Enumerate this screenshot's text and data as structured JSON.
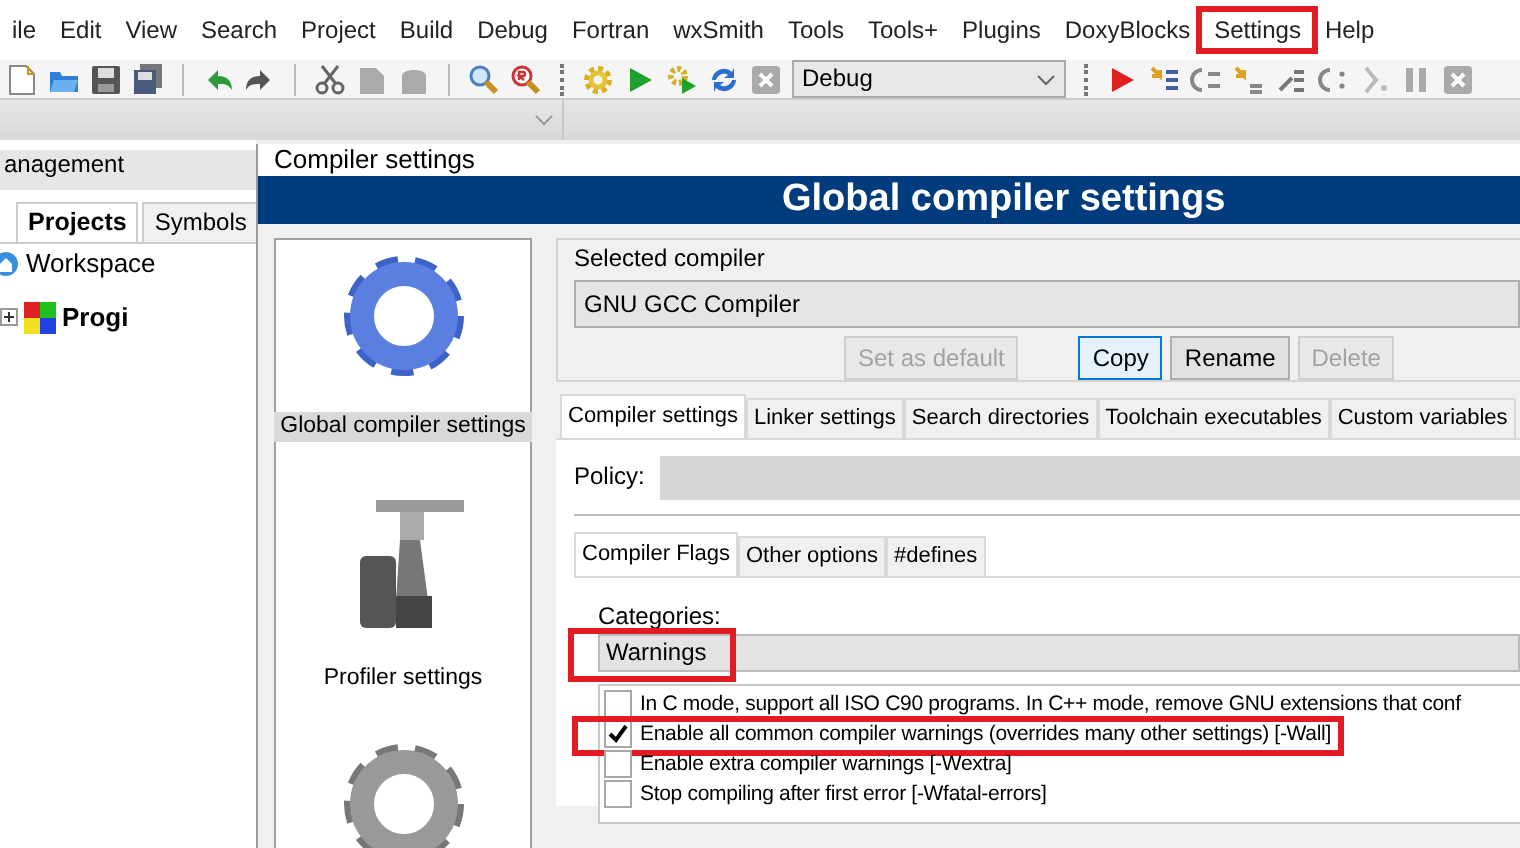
{
  "menu": [
    {
      "label": "ile",
      "highlighted": false
    },
    {
      "label": "Edit",
      "highlighted": false
    },
    {
      "label": "View",
      "highlighted": false
    },
    {
      "label": "Search",
      "highlighted": false
    },
    {
      "label": "Project",
      "highlighted": false
    },
    {
      "label": "Build",
      "highlighted": false
    },
    {
      "label": "Debug",
      "highlighted": false
    },
    {
      "label": "Fortran",
      "highlighted": false
    },
    {
      "label": "wxSmith",
      "highlighted": false
    },
    {
      "label": "Tools",
      "highlighted": false
    },
    {
      "label": "Tools+",
      "highlighted": false
    },
    {
      "label": "Plugins",
      "highlighted": false
    },
    {
      "label": "DoxyBlocks",
      "highlighted": false
    },
    {
      "label": "Settings",
      "highlighted": true
    },
    {
      "label": "Help",
      "highlighted": false
    }
  ],
  "toolbar": {
    "build_target": "Debug"
  },
  "management": {
    "title": "anagement",
    "tabs": [
      {
        "label": "Projects",
        "selected": true
      },
      {
        "label": "Symbols",
        "selected": false
      }
    ],
    "tree": [
      {
        "label": "Workspace",
        "kind": "workspace",
        "active": false,
        "children": [
          {
            "label": "Progi",
            "kind": "project",
            "active": true,
            "expanded": false
          }
        ]
      }
    ]
  },
  "dialog": {
    "title": "Compiler settings",
    "banner": "Global compiler settings",
    "pages": [
      {
        "label": "Global compiler settings",
        "kind": "gear",
        "selected": true
      },
      {
        "label": "Profiler settings",
        "kind": "caliper",
        "selected": false
      },
      {
        "kind": "gear-gray",
        "selected": false
      }
    ],
    "selected_compiler": {
      "legend": "Selected compiler",
      "value": "GNU GCC Compiler",
      "buttons": [
        {
          "label": "Set as default",
          "disabled": true,
          "focused": false
        },
        {
          "label": "Copy",
          "disabled": false,
          "focused": true
        },
        {
          "label": "Rename",
          "disabled": false,
          "focused": false
        },
        {
          "label": "Delete",
          "disabled": true,
          "focused": false
        }
      ]
    },
    "tabs": [
      {
        "label": "Compiler settings",
        "selected": true
      },
      {
        "label": "Linker settings",
        "selected": false
      },
      {
        "label": "Search directories",
        "selected": false
      },
      {
        "label": "Toolchain executables",
        "selected": false
      },
      {
        "label": "Custom variables",
        "selected": false
      }
    ],
    "policy": {
      "label": "Policy:"
    },
    "sub_tabs": [
      {
        "label": "Compiler Flags",
        "selected": true
      },
      {
        "label": "Other options",
        "selected": false
      },
      {
        "label": "#defines",
        "selected": false
      }
    ],
    "categories": {
      "label": "Categories:",
      "value": "Warnings",
      "highlighted": true
    },
    "options": [
      {
        "label": "In C mode, support all ISO C90 programs. In C++ mode, remove GNU extensions that conf",
        "checked": false,
        "highlighted": false
      },
      {
        "label": "Enable all common compiler warnings (overrides many other settings)  [-Wall]",
        "checked": true,
        "highlighted": true
      },
      {
        "label": "Enable extra compiler warnings  [-Wextra]",
        "checked": false,
        "highlighted": false
      },
      {
        "label": "Stop compiling after first error  [-Wfatal-errors]",
        "checked": false,
        "highlighted": false
      }
    ]
  }
}
